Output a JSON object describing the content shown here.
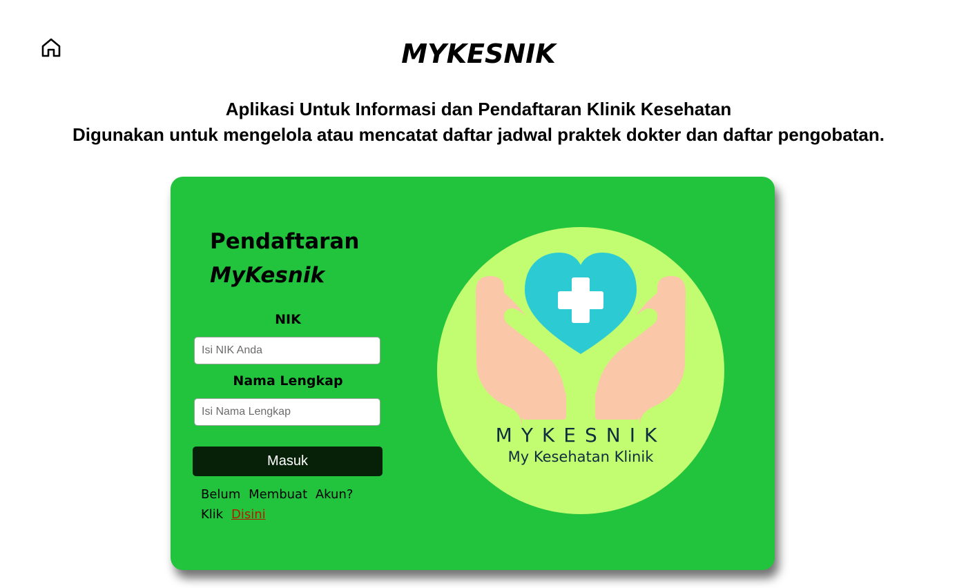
{
  "header": {
    "home_icon": "home-icon",
    "title": "MYKESNIK",
    "subtitle_line1": "Aplikasi Untuk Informasi dan Pendaftaran Klinik Kesehatan",
    "subtitle_line2": "Digunakan untuk mengelola atau mencatat daftar jadwal praktek dokter dan daftar pengobatan."
  },
  "form": {
    "title_line1": "Pendaftaran",
    "title_line2": "MyKesnik",
    "nik_label": "NIK",
    "nik_placeholder": "Isi NIK Anda",
    "nik_value": "",
    "name_label": "Nama Lengkap",
    "name_placeholder": "Isi Nama Lengkap",
    "name_value": "",
    "submit_label": "Masuk",
    "signup_prompt": "Belum Membuat Akun? Klik",
    "signup_link": "Disini"
  },
  "logo": {
    "brand": "MYKESNIK",
    "tagline": "My Kesehatan Klinik"
  },
  "colors": {
    "card_bg": "#22c43d",
    "button_bg": "#072109",
    "link": "#b51a00",
    "logo_circle": "#c2fc70",
    "heart": "#2ccbd4",
    "hands": "#fbc7a9"
  }
}
